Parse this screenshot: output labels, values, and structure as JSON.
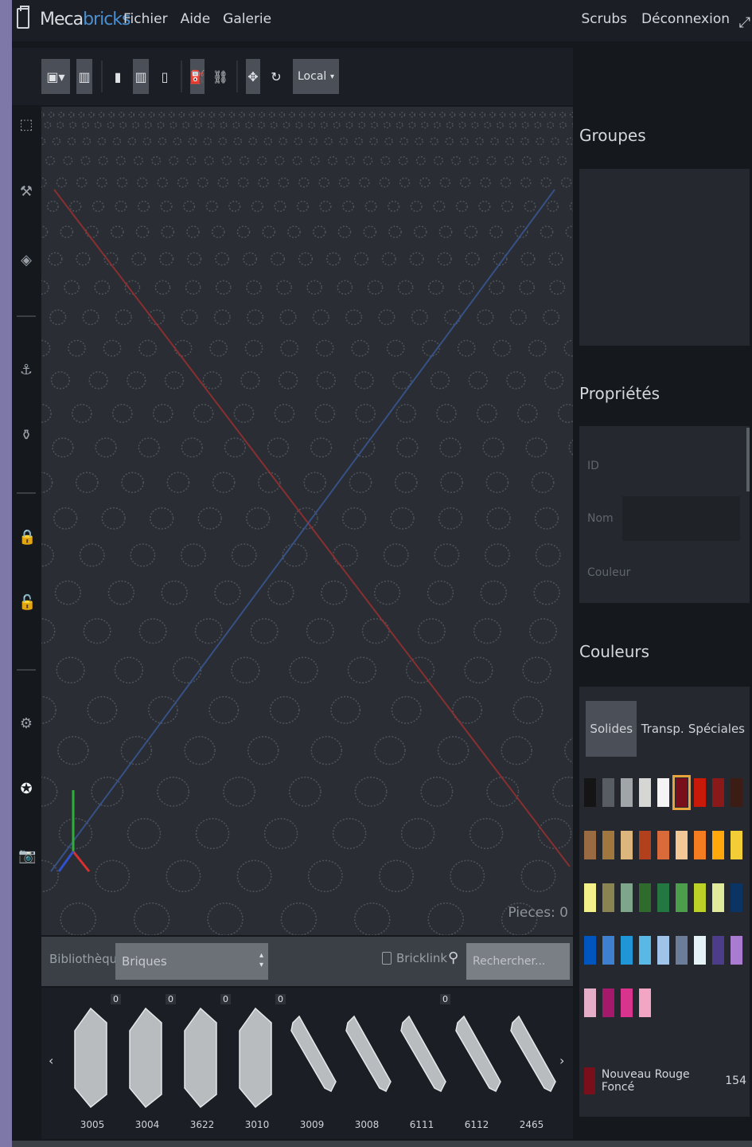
{
  "app": {
    "brand_part1": "Meca",
    "brand_part2": "bricks",
    "menu": [
      "Fichier",
      "Aide",
      "Galerie"
    ],
    "user_menu": [
      "Scrubs",
      "Déconnexion"
    ]
  },
  "toolbar": {
    "space_value": "Local"
  },
  "viewport": {
    "pieces_label": "Pieces: 0"
  },
  "library": {
    "breadcrumb": "Bibliothèque",
    "category": "Briques",
    "bricklink_label": "Bricklink",
    "search_placeholder": "Rechercher..."
  },
  "parts": [
    {
      "id": "3005",
      "count": "0"
    },
    {
      "id": "3004",
      "count": "0"
    },
    {
      "id": "3622",
      "count": "0"
    },
    {
      "id": "3010",
      "count": "0"
    },
    {
      "id": "3009",
      "count": ""
    },
    {
      "id": "3008",
      "count": ""
    },
    {
      "id": "6111",
      "count": "0"
    },
    {
      "id": "6112",
      "count": ""
    },
    {
      "id": "2465",
      "count": ""
    }
  ],
  "panels": {
    "groups_title": "Groupes",
    "properties_title": "Propriétés",
    "properties_labels": [
      "ID",
      "Nom",
      "Couleur"
    ],
    "colors_title": "Couleurs",
    "color_tabs": [
      "Solides",
      "Transp.",
      "Spéciales"
    ],
    "selected_color_name": "Nouveau Rouge Foncé",
    "selected_color_code": "154"
  },
  "palette": [
    [
      "#151515",
      "#575d62",
      "#a0a5a9",
      "#d6d7d4",
      "#f4f4f4",
      "#7a0f1c",
      "#c91a09",
      "#8a1a1a",
      "#3c1d16"
    ],
    [
      "#9a6a42",
      "#a0773f",
      "#dcb67c",
      "#b3401d",
      "#d96b3b",
      "#f4c796",
      "#f57c20",
      "#ffa70b",
      "#f2cd37"
    ],
    [
      "#f4f18b",
      "#8a8452",
      "#7fa58c",
      "#2f6b2c",
      "#237841",
      "#4b9f4a",
      "#bbd125",
      "#e0ea9a",
      "#0a3463"
    ],
    [
      "#0055bf",
      "#3f7fcf",
      "#2096d6",
      "#5ab8e6",
      "#9fc3e9",
      "#6c7d99",
      "#e4f2f7",
      "#4c3c8a",
      "#a97bd1"
    ],
    [
      "#e4adc8",
      "#a5196c",
      "#d8338d",
      "#f3a5c4"
    ]
  ],
  "selected_swatch": "#7a0f1c"
}
